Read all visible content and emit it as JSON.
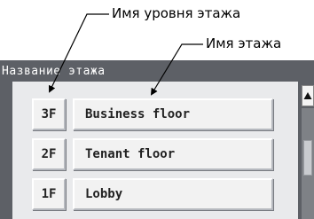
{
  "annotations": {
    "floor_level_name": "Имя уровня этажа",
    "floor_name": "Имя этажа"
  },
  "screen": {
    "title": "Название этажа"
  },
  "floors": [
    {
      "level": "3F",
      "name": "Business floor"
    },
    {
      "level": "2F",
      "name": "Tenant floor"
    },
    {
      "level": "1F",
      "name": "Lobby"
    }
  ],
  "icons": {
    "scroll_up": "triangle-up-icon"
  }
}
